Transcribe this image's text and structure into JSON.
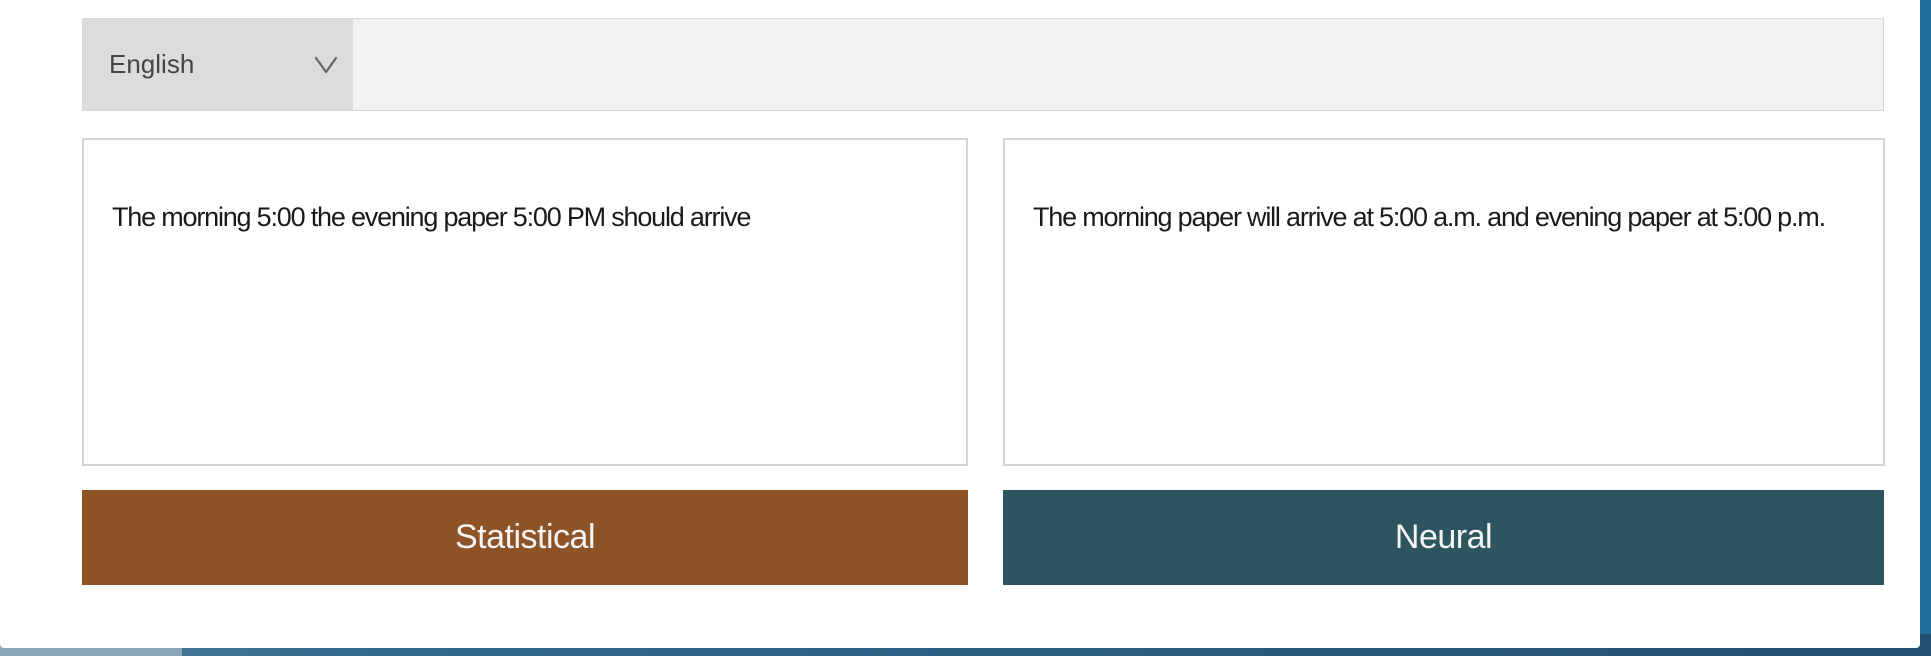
{
  "language_selector": {
    "selected": "English",
    "icon": "chevron-down-icon"
  },
  "statistical_output": {
    "text": "The morning 5:00 the evening paper 5:00 PM should arrive"
  },
  "neural_output": {
    "text": "The morning paper will arrive at 5:00 a.m. and evening paper at 5:00 p.m."
  },
  "buttons": {
    "statistical_label": "Statistical",
    "neural_label": "Neural"
  },
  "colors": {
    "statistical": "#8e5227",
    "neural": "#2d5560",
    "selector_bg": "#dcdcdc",
    "bar_bg": "#f2f2f2"
  }
}
